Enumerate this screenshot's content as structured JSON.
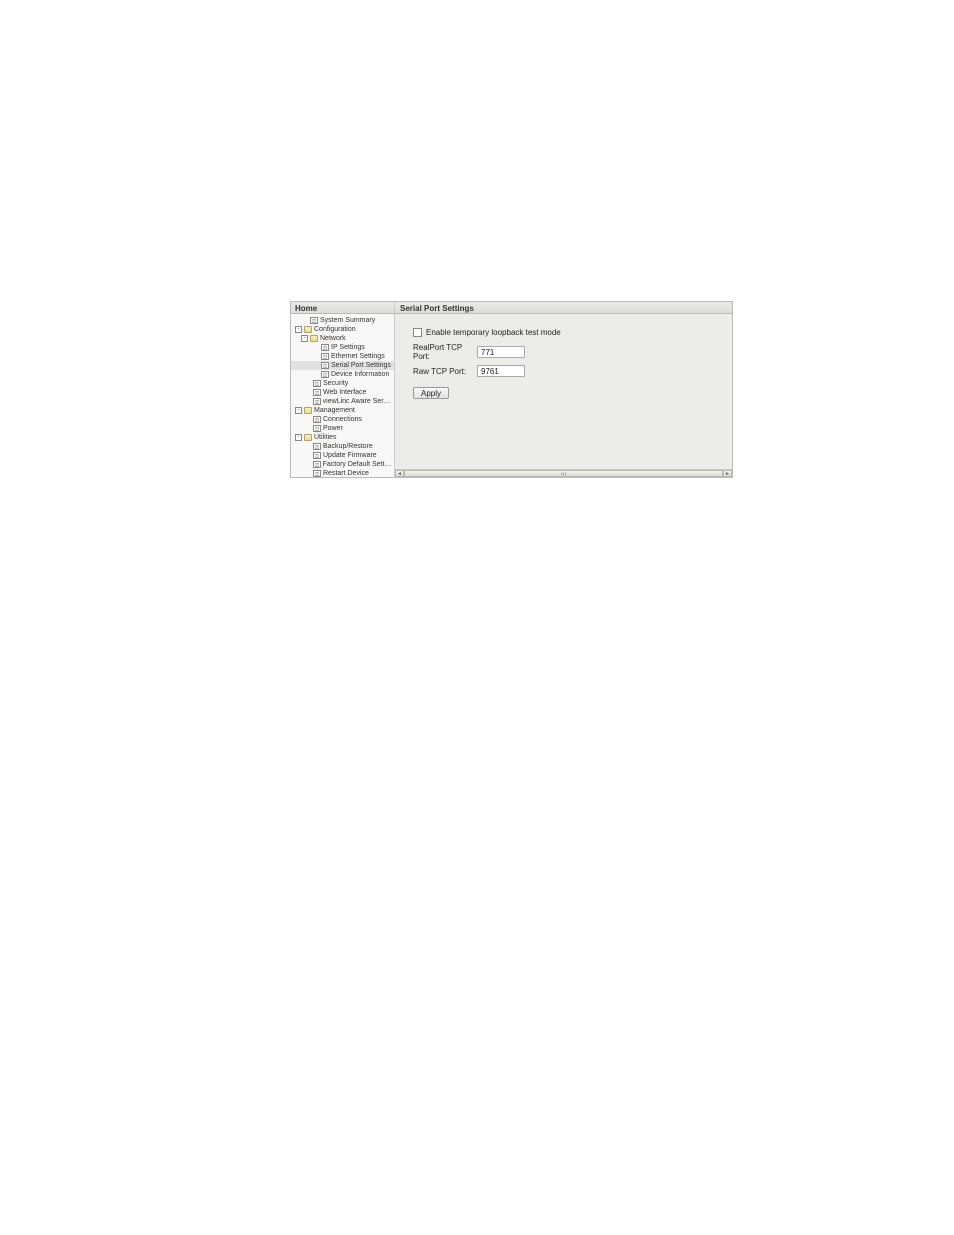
{
  "sidebar": {
    "title": "Home",
    "nodes": [
      {
        "label": "System Summary",
        "type": "page",
        "indent": 1,
        "toggle": null
      },
      {
        "label": "Configuration",
        "type": "folder",
        "indent": 0,
        "toggle": "-"
      },
      {
        "label": "Network",
        "type": "folder",
        "indent": 1,
        "toggle": "-"
      },
      {
        "label": "IP Settings",
        "type": "page",
        "indent": 3,
        "toggle": null
      },
      {
        "label": "Ethernet Settings",
        "type": "page",
        "indent": 3,
        "toggle": null
      },
      {
        "label": "Serial Port Settings",
        "type": "page",
        "indent": 3,
        "toggle": null,
        "selected": true
      },
      {
        "label": "Device Information",
        "type": "page",
        "indent": 3,
        "toggle": null
      },
      {
        "label": "Security",
        "type": "page",
        "indent": 2,
        "toggle": null
      },
      {
        "label": "Web Interface",
        "type": "page",
        "indent": 2,
        "toggle": null
      },
      {
        "label": "viewLinc Aware Service",
        "type": "page",
        "indent": 2,
        "toggle": null
      },
      {
        "label": "Management",
        "type": "folder",
        "indent": 0,
        "toggle": "-"
      },
      {
        "label": "Connections",
        "type": "page",
        "indent": 2,
        "toggle": null
      },
      {
        "label": "Power",
        "type": "page",
        "indent": 2,
        "toggle": null
      },
      {
        "label": "Utilities",
        "type": "folder",
        "indent": 0,
        "toggle": "-"
      },
      {
        "label": "Backup/Restore",
        "type": "page",
        "indent": 2,
        "toggle": null
      },
      {
        "label": "Update Firmware",
        "type": "page",
        "indent": 2,
        "toggle": null
      },
      {
        "label": "Factory Default Settings",
        "type": "page",
        "indent": 2,
        "toggle": null
      },
      {
        "label": "Restart Device",
        "type": "page",
        "indent": 2,
        "toggle": null
      }
    ]
  },
  "content": {
    "title": "Serial Port Settings",
    "checkbox": {
      "label": "Enable temporary loopback test mode",
      "checked": false
    },
    "fields": {
      "realport": {
        "label": "RealPort TCP Port:",
        "value": "771"
      },
      "rawtcp": {
        "label": "Raw TCP Port:",
        "value": "9761"
      }
    },
    "apply_label": "Apply"
  }
}
